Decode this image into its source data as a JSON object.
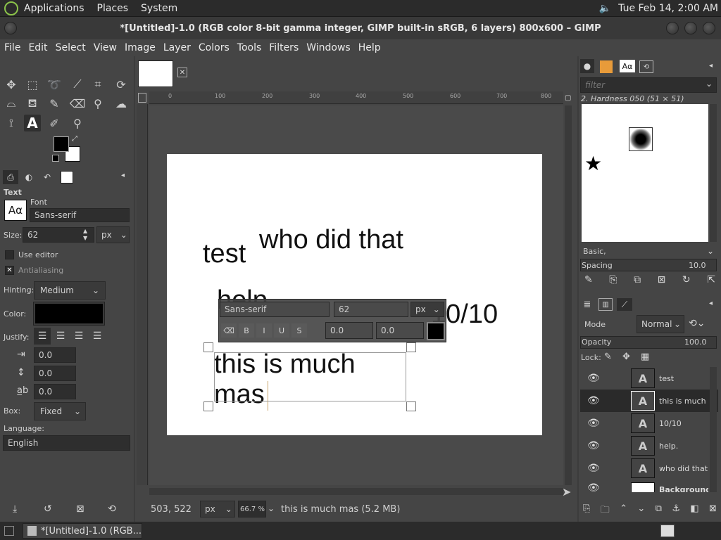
{
  "system_panel": {
    "menus": [
      "Applications",
      "Places",
      "System"
    ],
    "clock": "Tue Feb 14,  2:00 AM"
  },
  "window": {
    "title": "*[Untitled]-1.0 (RGB color 8-bit gamma integer, GIMP built-in sRGB, 6 layers) 800x600 – GIMP"
  },
  "menubar": [
    "File",
    "Edit",
    "Select",
    "View",
    "Image",
    "Layer",
    "Colors",
    "Tools",
    "Filters",
    "Windows",
    "Help"
  ],
  "tool_options": {
    "section_title": "Text",
    "font_label": "Font",
    "font_value": "Sans-serif",
    "font_preview": "Aα",
    "size_label": "Size:",
    "size_value": "62",
    "size_unit": "px",
    "use_editor": "Use editor",
    "antialiasing": "Antialiasing",
    "hinting_label": "Hinting:",
    "hinting_value": "Medium",
    "color_label": "Color:",
    "justify_label": "Justify:",
    "indent_value": "0.0",
    "line_spacing_value": "0.0",
    "letter_spacing_value": "0.0",
    "box_label": "Box:",
    "box_value": "Fixed",
    "language_label": "Language:",
    "language_value": "English"
  },
  "canvas": {
    "texts": {
      "t1": "test",
      "t2": "who did that",
      "t3": "help.",
      "t4": "10/10",
      "t5a": "this is much",
      "t5b": "mas"
    },
    "text_toolbar": {
      "font": "Sans-serif",
      "size": "62",
      "unit": "px",
      "baseline": "0.0",
      "kerning": "0.0"
    },
    "ruler_ticks": [
      "0",
      "100",
      "200",
      "300",
      "400",
      "500",
      "600",
      "700",
      "800"
    ]
  },
  "status_bar": {
    "coords": "503, 522",
    "unit": "px",
    "zoom": "66.7 %",
    "message": "this is much mas (5.2 MB)"
  },
  "brushes": {
    "filter_placeholder": "filter",
    "current": "2. Hardness 050 (51 × 51)",
    "tag": "Basic,",
    "spacing_label": "Spacing",
    "spacing_value": "10.0"
  },
  "layers": {
    "mode_label": "Mode",
    "mode_value": "Normal",
    "opacity_label": "Opacity",
    "opacity_value": "100.0",
    "lock_label": "Lock:",
    "items": [
      {
        "name": "test"
      },
      {
        "name": "this is much mas"
      },
      {
        "name": "10/10"
      },
      {
        "name": "help."
      },
      {
        "name": "who did that"
      },
      {
        "name": "Background"
      }
    ]
  },
  "taskbar": {
    "item": "*[Untitled]-1.0 (RGB..."
  }
}
